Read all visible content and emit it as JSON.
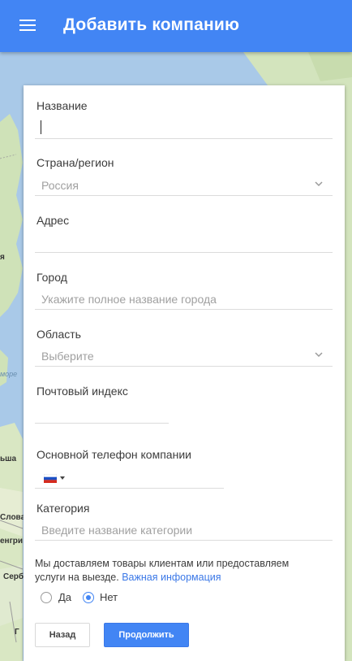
{
  "appbar": {
    "title": "Добавить компанию"
  },
  "form": {
    "name": {
      "label": "Название",
      "value": ""
    },
    "country": {
      "label": "Страна/регион",
      "value": "Россия"
    },
    "address": {
      "label": "Адрес",
      "value": ""
    },
    "city": {
      "label": "Город",
      "placeholder": "Укажите полное название города"
    },
    "region": {
      "label": "Область",
      "value": "Выберите"
    },
    "postal": {
      "label": "Почтовый индекс",
      "value": ""
    },
    "phone": {
      "label": "Основной телефон компании",
      "value": ""
    },
    "category": {
      "label": "Категория",
      "placeholder": "Введите название категории"
    },
    "delivery": {
      "text": "Мы доставляем товары клиентам или предоставляем услуги на выезде.",
      "link": "Важная информация",
      "options": [
        {
          "label": "Да",
          "checked": false
        },
        {
          "label": "Нет",
          "checked": true
        }
      ]
    }
  },
  "buttons": {
    "back": "Назад",
    "next": "Продолжить"
  },
  "map_labels": {
    "a": "я",
    "b": "море",
    "c": "ьша",
    "d": "Слова",
    "e": "енгри",
    "f": "Серб",
    "g": "Г"
  },
  "colors": {
    "primary": "#4285f4",
    "link": "#3b78e7",
    "water": "#a9c9e8",
    "land": "#d6e6c4"
  }
}
